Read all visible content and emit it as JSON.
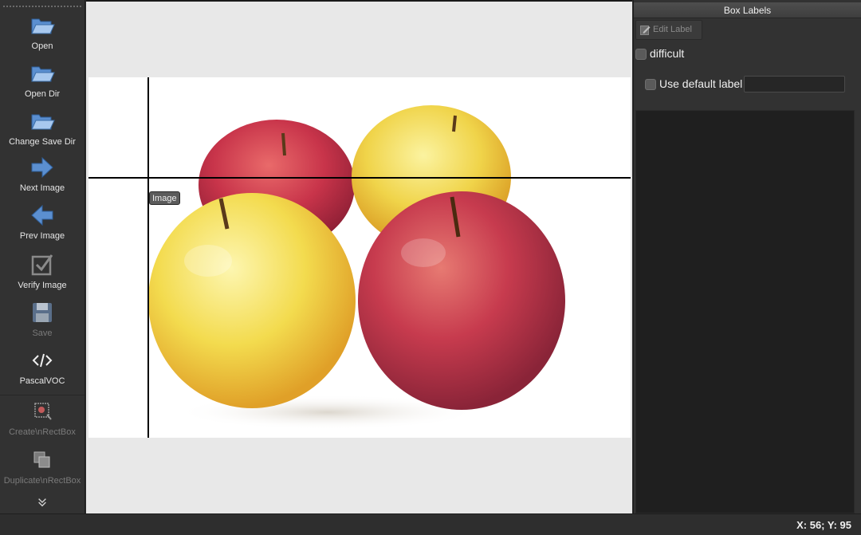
{
  "toolbar": {
    "open": "Open",
    "open_dir": "Open Dir",
    "change_save_dir": "Change Save Dir",
    "next_image": "Next Image",
    "prev_image": "Prev Image",
    "verify_image": "Verify Image",
    "save": "Save",
    "format": "PascalVOC",
    "create_rect_box": "Create\\nRectBox",
    "duplicate_rect_box": "Duplicate\\nRectBox"
  },
  "canvas": {
    "tooltip": "Image"
  },
  "dock": {
    "title": "Box Labels",
    "edit_label": "Edit Label",
    "difficult": "difficult",
    "use_default_label": "Use default label",
    "default_label_value": ""
  },
  "status": {
    "coords": "X: 56; Y: 95"
  },
  "colors": {
    "toolbar_bg": "#323232",
    "canvas_bg": "#e8e8e8",
    "list_bg": "#1f1f1f",
    "icon_blue": "#4a7fc1"
  },
  "icons": [
    "folder-open-icon",
    "folder-open-icon",
    "folder-open-icon",
    "arrow-right-icon",
    "arrow-left-icon",
    "checkbox-verify-icon",
    "floppy-disk-icon",
    "code-tag-icon",
    "create-rect-box-icon",
    "duplicate-box-icon",
    "chevron-double-down-icon"
  ]
}
